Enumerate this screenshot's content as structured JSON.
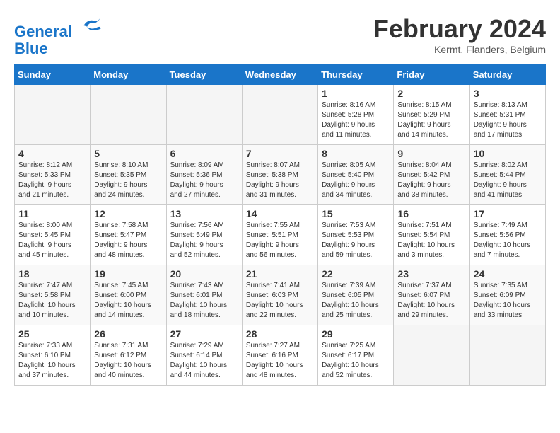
{
  "logo": {
    "line1": "General",
    "line2": "Blue"
  },
  "title": "February 2024",
  "location": "Kermt, Flanders, Belgium",
  "days_header": [
    "Sunday",
    "Monday",
    "Tuesday",
    "Wednesday",
    "Thursday",
    "Friday",
    "Saturday"
  ],
  "weeks": [
    [
      {
        "num": "",
        "info": ""
      },
      {
        "num": "",
        "info": ""
      },
      {
        "num": "",
        "info": ""
      },
      {
        "num": "",
        "info": ""
      },
      {
        "num": "1",
        "info": "Sunrise: 8:16 AM\nSunset: 5:28 PM\nDaylight: 9 hours\nand 11 minutes."
      },
      {
        "num": "2",
        "info": "Sunrise: 8:15 AM\nSunset: 5:29 PM\nDaylight: 9 hours\nand 14 minutes."
      },
      {
        "num": "3",
        "info": "Sunrise: 8:13 AM\nSunset: 5:31 PM\nDaylight: 9 hours\nand 17 minutes."
      }
    ],
    [
      {
        "num": "4",
        "info": "Sunrise: 8:12 AM\nSunset: 5:33 PM\nDaylight: 9 hours\nand 21 minutes."
      },
      {
        "num": "5",
        "info": "Sunrise: 8:10 AM\nSunset: 5:35 PM\nDaylight: 9 hours\nand 24 minutes."
      },
      {
        "num": "6",
        "info": "Sunrise: 8:09 AM\nSunset: 5:36 PM\nDaylight: 9 hours\nand 27 minutes."
      },
      {
        "num": "7",
        "info": "Sunrise: 8:07 AM\nSunset: 5:38 PM\nDaylight: 9 hours\nand 31 minutes."
      },
      {
        "num": "8",
        "info": "Sunrise: 8:05 AM\nSunset: 5:40 PM\nDaylight: 9 hours\nand 34 minutes."
      },
      {
        "num": "9",
        "info": "Sunrise: 8:04 AM\nSunset: 5:42 PM\nDaylight: 9 hours\nand 38 minutes."
      },
      {
        "num": "10",
        "info": "Sunrise: 8:02 AM\nSunset: 5:44 PM\nDaylight: 9 hours\nand 41 minutes."
      }
    ],
    [
      {
        "num": "11",
        "info": "Sunrise: 8:00 AM\nSunset: 5:45 PM\nDaylight: 9 hours\nand 45 minutes."
      },
      {
        "num": "12",
        "info": "Sunrise: 7:58 AM\nSunset: 5:47 PM\nDaylight: 9 hours\nand 48 minutes."
      },
      {
        "num": "13",
        "info": "Sunrise: 7:56 AM\nSunset: 5:49 PM\nDaylight: 9 hours\nand 52 minutes."
      },
      {
        "num": "14",
        "info": "Sunrise: 7:55 AM\nSunset: 5:51 PM\nDaylight: 9 hours\nand 56 minutes."
      },
      {
        "num": "15",
        "info": "Sunrise: 7:53 AM\nSunset: 5:53 PM\nDaylight: 9 hours\nand 59 minutes."
      },
      {
        "num": "16",
        "info": "Sunrise: 7:51 AM\nSunset: 5:54 PM\nDaylight: 10 hours\nand 3 minutes."
      },
      {
        "num": "17",
        "info": "Sunrise: 7:49 AM\nSunset: 5:56 PM\nDaylight: 10 hours\nand 7 minutes."
      }
    ],
    [
      {
        "num": "18",
        "info": "Sunrise: 7:47 AM\nSunset: 5:58 PM\nDaylight: 10 hours\nand 10 minutes."
      },
      {
        "num": "19",
        "info": "Sunrise: 7:45 AM\nSunset: 6:00 PM\nDaylight: 10 hours\nand 14 minutes."
      },
      {
        "num": "20",
        "info": "Sunrise: 7:43 AM\nSunset: 6:01 PM\nDaylight: 10 hours\nand 18 minutes."
      },
      {
        "num": "21",
        "info": "Sunrise: 7:41 AM\nSunset: 6:03 PM\nDaylight: 10 hours\nand 22 minutes."
      },
      {
        "num": "22",
        "info": "Sunrise: 7:39 AM\nSunset: 6:05 PM\nDaylight: 10 hours\nand 25 minutes."
      },
      {
        "num": "23",
        "info": "Sunrise: 7:37 AM\nSunset: 6:07 PM\nDaylight: 10 hours\nand 29 minutes."
      },
      {
        "num": "24",
        "info": "Sunrise: 7:35 AM\nSunset: 6:09 PM\nDaylight: 10 hours\nand 33 minutes."
      }
    ],
    [
      {
        "num": "25",
        "info": "Sunrise: 7:33 AM\nSunset: 6:10 PM\nDaylight: 10 hours\nand 37 minutes."
      },
      {
        "num": "26",
        "info": "Sunrise: 7:31 AM\nSunset: 6:12 PM\nDaylight: 10 hours\nand 40 minutes."
      },
      {
        "num": "27",
        "info": "Sunrise: 7:29 AM\nSunset: 6:14 PM\nDaylight: 10 hours\nand 44 minutes."
      },
      {
        "num": "28",
        "info": "Sunrise: 7:27 AM\nSunset: 6:16 PM\nDaylight: 10 hours\nand 48 minutes."
      },
      {
        "num": "29",
        "info": "Sunrise: 7:25 AM\nSunset: 6:17 PM\nDaylight: 10 hours\nand 52 minutes."
      },
      {
        "num": "",
        "info": ""
      },
      {
        "num": "",
        "info": ""
      }
    ]
  ]
}
